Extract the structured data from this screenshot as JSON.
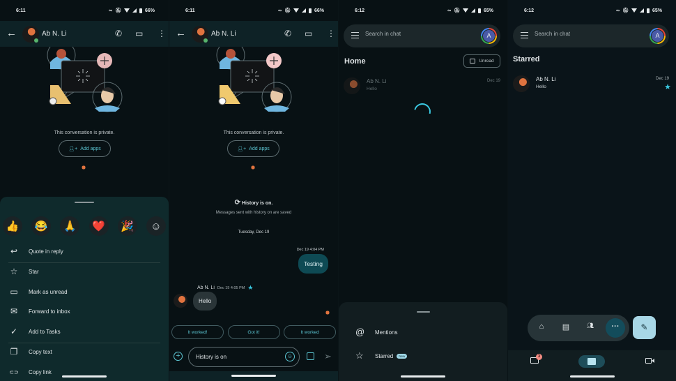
{
  "panels": [
    {
      "status": {
        "time": "6:11",
        "battery": "66%"
      },
      "header": {
        "contact_name": "Ab N. Li"
      },
      "private_text": "This conversation is private.",
      "add_apps_label": "Add apps",
      "reactions": [
        {
          "name": "thumbs-up",
          "glyph": "👍"
        },
        {
          "name": "joy",
          "glyph": "😂"
        },
        {
          "name": "pray",
          "glyph": "🙏"
        },
        {
          "name": "heart",
          "glyph": "❤️"
        },
        {
          "name": "party",
          "glyph": "🎉"
        },
        {
          "name": "add-reaction",
          "glyph": "☺"
        }
      ],
      "menu": [
        {
          "icon": "reply-icon",
          "glyph": "↩",
          "label": "Quote in reply"
        },
        {
          "icon": "star-icon",
          "glyph": "☆",
          "label": "Star"
        },
        {
          "icon": "mark-unread-icon",
          "glyph": "▭",
          "label": "Mark as unread"
        },
        {
          "icon": "forward-mail-icon",
          "glyph": "✉",
          "label": "Forward to inbox"
        },
        {
          "icon": "add-task-icon",
          "glyph": "✓",
          "label": "Add to Tasks"
        },
        {
          "icon": "copy-icon",
          "glyph": "❐",
          "label": "Copy text"
        },
        {
          "icon": "link-icon",
          "glyph": "⊂⊃",
          "label": "Copy link"
        }
      ]
    },
    {
      "status": {
        "time": "6:11",
        "battery": "66%"
      },
      "header": {
        "contact_name": "Ab N. Li"
      },
      "private_text": "This conversation is private.",
      "add_apps_label": "Add apps",
      "history_title": "History is on.",
      "history_sub": "Messages sent with history on are saved",
      "date_divider": "Tuesday, Dec 19",
      "outgoing": {
        "timestamp": "Dec 19 4:04 PM",
        "text": "Testing"
      },
      "incoming": {
        "sender": "Ab N. Li",
        "timestamp": "Dec 19 4:05 PM",
        "text": "Hello",
        "starred": true
      },
      "smart_replies": [
        "It worked!",
        "Got it!",
        "It worked"
      ],
      "composer": {
        "placeholder": "History is on"
      }
    },
    {
      "status": {
        "time": "6:12",
        "battery": "65%"
      },
      "search_placeholder": "Search in chat",
      "account_initial": "A",
      "section_title": "Home",
      "unread_button": "Unread",
      "conversations": [
        {
          "name": "Ab N. Li",
          "message": "Hello",
          "date": "Dec 19"
        }
      ],
      "sheet": [
        {
          "icon": "at-icon",
          "glyph": "@",
          "label": "Mentions"
        },
        {
          "icon": "star-icon",
          "glyph": "☆",
          "label": "Starred",
          "badge": "New"
        }
      ]
    },
    {
      "status": {
        "time": "6:12",
        "battery": "65%"
      },
      "search_placeholder": "Search in chat",
      "account_initial": "A",
      "section_title": "Starred",
      "conversations": [
        {
          "name": "Ab N. Li",
          "message": "Hello",
          "date": "Dec 19",
          "starred": true
        }
      ],
      "fab_nav": [
        "home",
        "chats",
        "spaces",
        "more"
      ],
      "bottom_nav": {
        "mail_badge": "3",
        "active": "chat"
      }
    }
  ],
  "colors": {
    "accent": "#3ac8e0",
    "link": "#5cc6d3",
    "outgoing_bubble": "#0e4a54",
    "sheet": "#0f2a2c"
  }
}
